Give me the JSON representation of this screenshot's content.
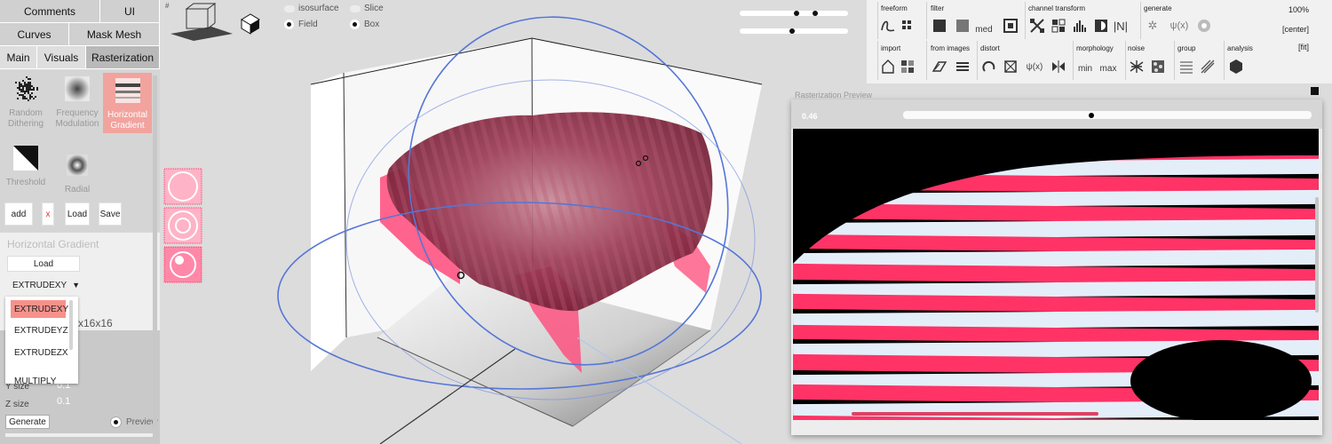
{
  "top_tabs": [
    "Comments",
    "UI"
  ],
  "mid_tabs": [
    "Curves",
    "Mask Mesh"
  ],
  "sub_tabs": [
    "Main",
    "Visuals",
    "Rasterization"
  ],
  "active_sub_tab": "Rasterization",
  "tools": [
    {
      "label": "Random Dithering",
      "icon": "dither-icon"
    },
    {
      "label": "Frequency Modulation",
      "icon": "frequency-modulation-icon"
    },
    {
      "label": "Horizontal Gradient",
      "icon": "horizontal-gradient-icon",
      "active": true
    },
    {
      "label": "Threshold",
      "icon": "threshold-icon"
    },
    {
      "label": "Radial",
      "icon": "radial-icon"
    }
  ],
  "actions": {
    "add": "add",
    "remove": "x",
    "load": "Load",
    "save": "Save"
  },
  "props": {
    "title": "Horizontal Gradient",
    "load": "Load",
    "mode_selected": "EXTRUDEXY",
    "mode_options": [
      "EXTRUDEXY",
      "EXTRUDEYZ",
      "EXTRUDEZX",
      "MULTIPLY"
    ],
    "size_fragment": "x16x16",
    "ysize_label": "Y size",
    "ysize_value": "0.1",
    "zsize_label": "Z size",
    "zsize_value": "0.1",
    "generate": "Generate",
    "preview": "Preview"
  },
  "viewport": {
    "hash": "#",
    "isosurface": "isosurface",
    "slice": "Slice",
    "field": "Field",
    "box": "Box",
    "render_mode_field": true,
    "render_mode_box": true
  },
  "toolbar": {
    "groups": [
      {
        "name": "freeform"
      },
      {
        "name": "filter"
      },
      {
        "name": "channel transform"
      },
      {
        "name": "generate"
      },
      {
        "name": "import"
      },
      {
        "name": "from images"
      },
      {
        "name": "distort"
      },
      {
        "name": "morphology"
      },
      {
        "name": "noise"
      },
      {
        "name": "group"
      },
      {
        "name": "analysis"
      }
    ],
    "filter_med": "med",
    "channel_n": "|N|",
    "generate_psi": "ψ(x)",
    "morph_min": "min",
    "morph_max": "max",
    "zoom": "100%",
    "center": "[center]",
    "fit": "[fit]"
  },
  "raster_preview": {
    "title": "Rasterization Preview",
    "value": "0.46",
    "slider_fraction": 0.46
  },
  "colors": {
    "stripe_pink": "#ff3366",
    "stripe_light": "#e4eef9",
    "accent": "#f7918b",
    "surface": "#7a1f36"
  }
}
